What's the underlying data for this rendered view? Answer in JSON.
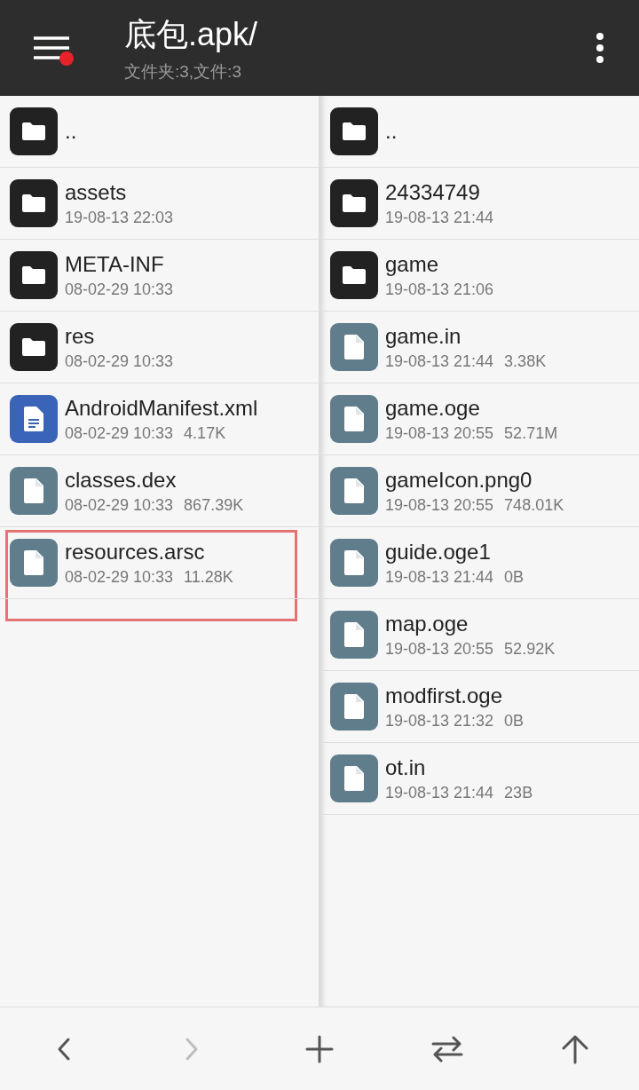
{
  "header": {
    "title": "底包.apk/",
    "subtitle": "文件夹:3,文件:3",
    "menu_badge": true
  },
  "panes": [
    {
      "items": [
        {
          "kind": "folder",
          "name": "..",
          "highlighted": false
        },
        {
          "kind": "folder",
          "name": "assets",
          "date": "19-08-13 22:03",
          "highlighted": false
        },
        {
          "kind": "folder",
          "name": "META-INF",
          "date": "08-02-29 10:33",
          "highlighted": false
        },
        {
          "kind": "folder",
          "name": "res",
          "date": "08-02-29 10:33",
          "highlighted": false
        },
        {
          "kind": "xml",
          "name": "AndroidManifest.xml",
          "date": "08-02-29 10:33",
          "size": "4.17K",
          "highlighted": false
        },
        {
          "kind": "file",
          "name": "classes.dex",
          "date": "08-02-29 10:33",
          "size": "867.39K",
          "highlighted": false
        },
        {
          "kind": "file",
          "name": "resources.arsc",
          "date": "08-02-29 10:33",
          "size": "11.28K",
          "highlighted": true
        }
      ]
    },
    {
      "items": [
        {
          "kind": "folder",
          "name": "..",
          "highlighted": false
        },
        {
          "kind": "folder",
          "name": "24334749",
          "date": "19-08-13 21:44",
          "highlighted": false
        },
        {
          "kind": "folder",
          "name": "game",
          "date": "19-08-13 21:06",
          "highlighted": false
        },
        {
          "kind": "file",
          "name": "game.in",
          "date": "19-08-13 21:44",
          "size": "3.38K",
          "highlighted": false
        },
        {
          "kind": "file",
          "name": "game.oge",
          "date": "19-08-13 20:55",
          "size": "52.71M",
          "highlighted": false
        },
        {
          "kind": "file",
          "name": "gameIcon.png0",
          "date": "19-08-13 20:55",
          "size": "748.01K",
          "highlighted": false
        },
        {
          "kind": "file",
          "name": "guide.oge1",
          "date": "19-08-13 21:44",
          "size": "0B",
          "highlighted": false
        },
        {
          "kind": "file",
          "name": "map.oge",
          "date": "19-08-13 20:55",
          "size": "52.92K",
          "highlighted": false
        },
        {
          "kind": "file",
          "name": "modfirst.oge",
          "date": "19-08-13 21:32",
          "size": "0B",
          "highlighted": false
        },
        {
          "kind": "file",
          "name": "ot.in",
          "date": "19-08-13 21:44",
          "size": "23B",
          "highlighted": false
        }
      ]
    }
  ],
  "toolbar": [
    {
      "kind": "back",
      "disabled": false
    },
    {
      "kind": "forward",
      "disabled": true
    },
    {
      "kind": "add",
      "disabled": false
    },
    {
      "kind": "swap",
      "disabled": false
    },
    {
      "kind": "up",
      "disabled": false
    }
  ]
}
